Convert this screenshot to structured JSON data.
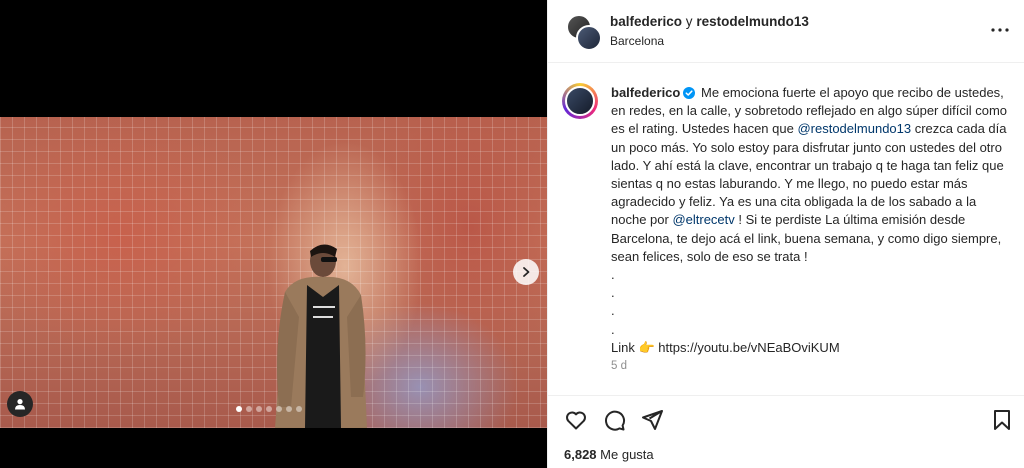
{
  "post": {
    "author_primary": "balfederico",
    "author_conjunction": "y",
    "author_collab": "restodelmundo13",
    "location": "Barcelona",
    "carousel": {
      "slide_count": 7,
      "active_index": 0
    }
  },
  "caption": {
    "username": "balfederico",
    "verified": true,
    "text_part1": "Me emociona fuerte el apoyo que recibo de ustedes, en redes, en la calle, y sobretodo reflejado en algo súper difícil como es el rating. Ustedes hacen que ",
    "mention1": "@restodelmundo13",
    "text_part2": " crezca cada día un poco más. Yo solo estoy para disfrutar junto con ustedes del otro lado. Y ahí está la clave, encontrar un trabajo q te haga tan feliz que sientas q no estas laburando. Y me llego, no puedo estar más agradecido y feliz. Ya es una cita obligada la de los sabado a la noche por ",
    "mention2": "@eltrecetv",
    "text_part3": " ! Si te perdiste La última emisión desde Barcelona, te dejo acá el link, buena semana, y como digo siempre, sean felices, solo de eso se trata !",
    "dots": [
      ".",
      ".",
      ".",
      "."
    ],
    "link_label": "Link",
    "link_emoji": "👉",
    "link_url": "https://youtu.be/vNEaBOviKUM",
    "age": "5 d"
  },
  "stats": {
    "likes_count": "6,828",
    "likes_label": "Me gusta"
  },
  "icons": {
    "like": "heart-icon",
    "comment": "comment-icon",
    "share": "share-icon",
    "save": "bookmark-icon",
    "more": "more-options-icon",
    "next": "chevron-right-icon",
    "tag": "user-tag-icon",
    "verified": "verified-badge-icon"
  },
  "colors": {
    "text": "#262626",
    "muted": "#8e8e8e",
    "mention": "#00376b",
    "verified": "#0095f6"
  }
}
